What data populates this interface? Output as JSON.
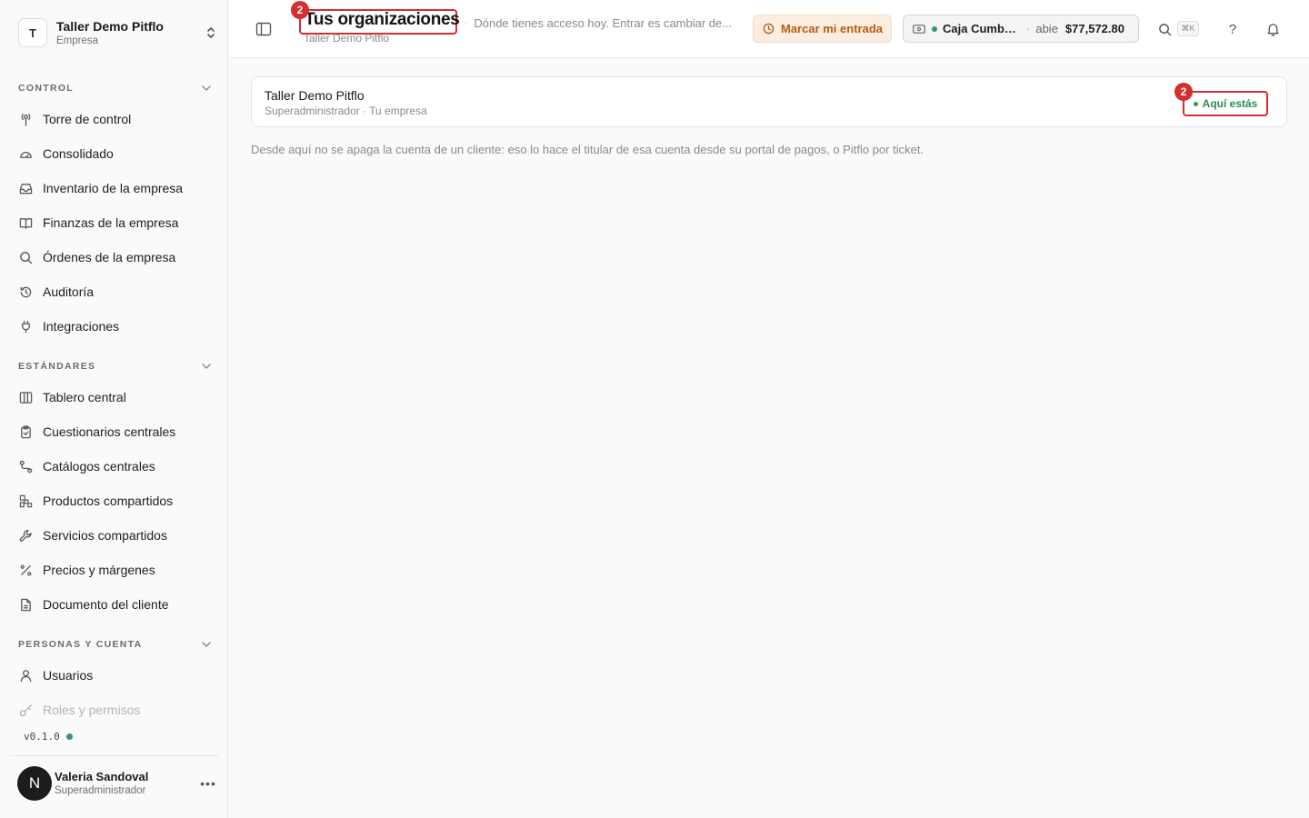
{
  "sidebar": {
    "org": {
      "initial": "T",
      "name": "Taller Demo Pitflo",
      "subtitle": "Empresa"
    },
    "sections": [
      {
        "label": "CONTROL",
        "items": [
          {
            "label": "Torre de control",
            "icon": "tower-icon"
          },
          {
            "label": "Consolidado",
            "icon": "gauge-icon"
          },
          {
            "label": "Inventario de la empresa",
            "icon": "inbox-icon"
          },
          {
            "label": "Finanzas de la empresa",
            "icon": "book-icon"
          },
          {
            "label": "Órdenes de la empresa",
            "icon": "search-icon"
          },
          {
            "label": "Auditoría",
            "icon": "history-icon"
          },
          {
            "label": "Integraciones",
            "icon": "plug-icon"
          }
        ]
      },
      {
        "label": "ESTÁNDARES",
        "items": [
          {
            "label": "Tablero central",
            "icon": "columns-icon"
          },
          {
            "label": "Cuestionarios centrales",
            "icon": "clipboard-icon"
          },
          {
            "label": "Catálogos centrales",
            "icon": "route-icon"
          },
          {
            "label": "Productos compartidos",
            "icon": "boxes-icon"
          },
          {
            "label": "Servicios compartidos",
            "icon": "wrench-icon"
          },
          {
            "label": "Precios y márgenes",
            "icon": "percent-icon"
          },
          {
            "label": "Documento del cliente",
            "icon": "file-icon"
          }
        ]
      },
      {
        "label": "PERSONAS Y CUENTA",
        "items": [
          {
            "label": "Usuarios",
            "icon": "user-icon"
          },
          {
            "label": "Roles y permisos",
            "icon": "key-icon"
          }
        ]
      }
    ],
    "version": "v0.1.0",
    "user": {
      "initial": "N",
      "name": "Valeria Sandoval",
      "role": "Superadministrador"
    }
  },
  "header": {
    "title": "Tus organizaciones",
    "subtitle": "Taller Demo Pitflo",
    "description": "Dónde tienes acceso hoy. Entrar es cambiar de...",
    "clock_in_label": "Marcar mi entrada",
    "cash": {
      "name": "Caja Cumbr...",
      "status": "abie",
      "amount": "$77,572.80"
    },
    "shortcut": "⌘K",
    "help_label": "?",
    "step_badge": "2"
  },
  "main": {
    "organizations": [
      {
        "name": "Taller Demo Pitflo",
        "details": "Superadministrador · Tu empresa",
        "status_label": "Aquí estás",
        "status_badge": "2"
      }
    ],
    "note": "Desde aquí no se apaga la cuenta de un cliente: eso lo hace el titular de esa cuenta desde su portal de pagos, o Pitflo por ticket."
  },
  "colors": {
    "accent_warning": "#b85c0f",
    "success": "#2e9b62",
    "highlight": "#d32f2f"
  }
}
